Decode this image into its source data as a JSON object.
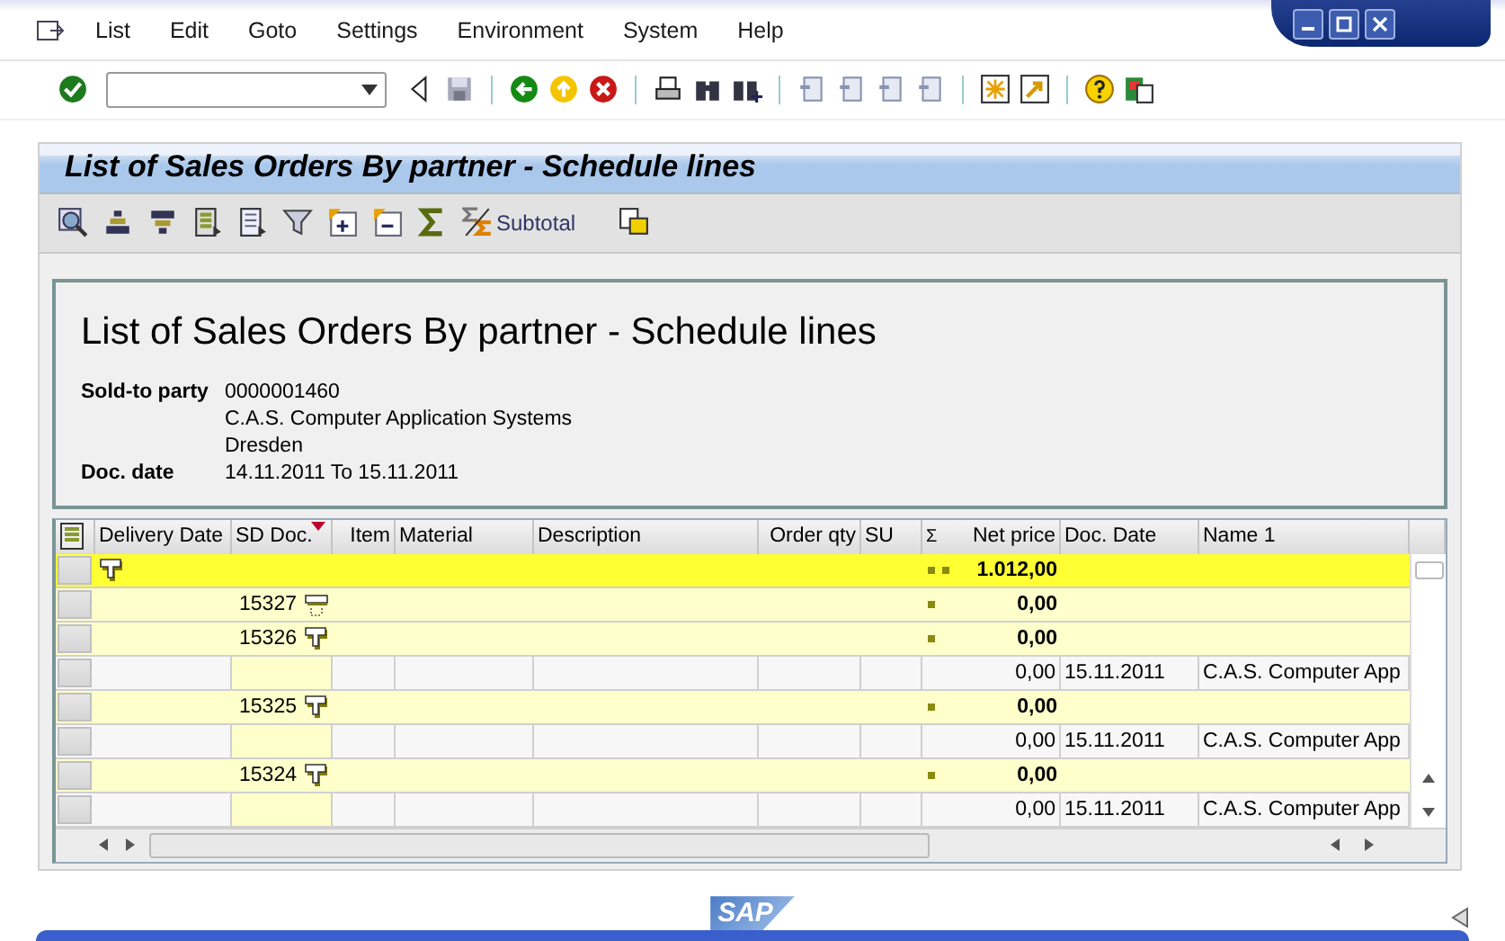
{
  "menu": [
    "List",
    "Edit",
    "Goto",
    "Settings",
    "Environment",
    "System",
    "Help"
  ],
  "title": "List of Sales Orders By partner - Schedule lines",
  "app_toolbar": {
    "subtotal_button": "Subtotal"
  },
  "header": {
    "heading": "List of Sales Orders By partner - Schedule lines",
    "fields": [
      {
        "label": "Sold-to party",
        "lines": [
          "0000001460",
          "C.A.S. Computer Application Systems",
          "Dresden"
        ]
      },
      {
        "label": "Doc. date",
        "lines": [
          "14.11.2011 To 15.11.2011"
        ]
      }
    ]
  },
  "table": {
    "columns": [
      {
        "label": "Delivery Date",
        "sorted": false
      },
      {
        "label": "SD Doc.",
        "sorted": true
      },
      {
        "label": "Item",
        "sorted": false
      },
      {
        "label": "Material",
        "sorted": false
      },
      {
        "label": "Description",
        "sorted": false
      },
      {
        "label": "Order qty",
        "sorted": false
      },
      {
        "label": "SU",
        "sorted": false
      },
      {
        "label": "Net price",
        "sorted": false,
        "sum_mark": "Σ"
      },
      {
        "label": "Doc. Date",
        "sorted": false
      },
      {
        "label": "Name 1",
        "sorted": false
      }
    ],
    "rows": [
      {
        "kind": "total",
        "expanded": true,
        "net_price": "1.012,00"
      },
      {
        "kind": "subtotal",
        "sd_doc": "15327",
        "expanded": false,
        "net_price": "0,00"
      },
      {
        "kind": "subtotal",
        "sd_doc": "15326",
        "expanded": true,
        "net_price": "0,00"
      },
      {
        "kind": "item",
        "net_price": "0,00",
        "doc_date": "15.11.2011",
        "name_1": "C.A.S. Computer App"
      },
      {
        "kind": "subtotal",
        "sd_doc": "15325",
        "expanded": true,
        "net_price": "0,00"
      },
      {
        "kind": "item",
        "net_price": "0,00",
        "doc_date": "15.11.2011",
        "name_1": "C.A.S. Computer App"
      },
      {
        "kind": "subtotal",
        "sd_doc": "15324",
        "expanded": true,
        "net_price": "0,00"
      },
      {
        "kind": "item",
        "net_price": "0,00",
        "doc_date": "15.11.2011",
        "name_1": "C.A.S. Computer App"
      }
    ]
  },
  "footer": {
    "logo": "SAP"
  }
}
